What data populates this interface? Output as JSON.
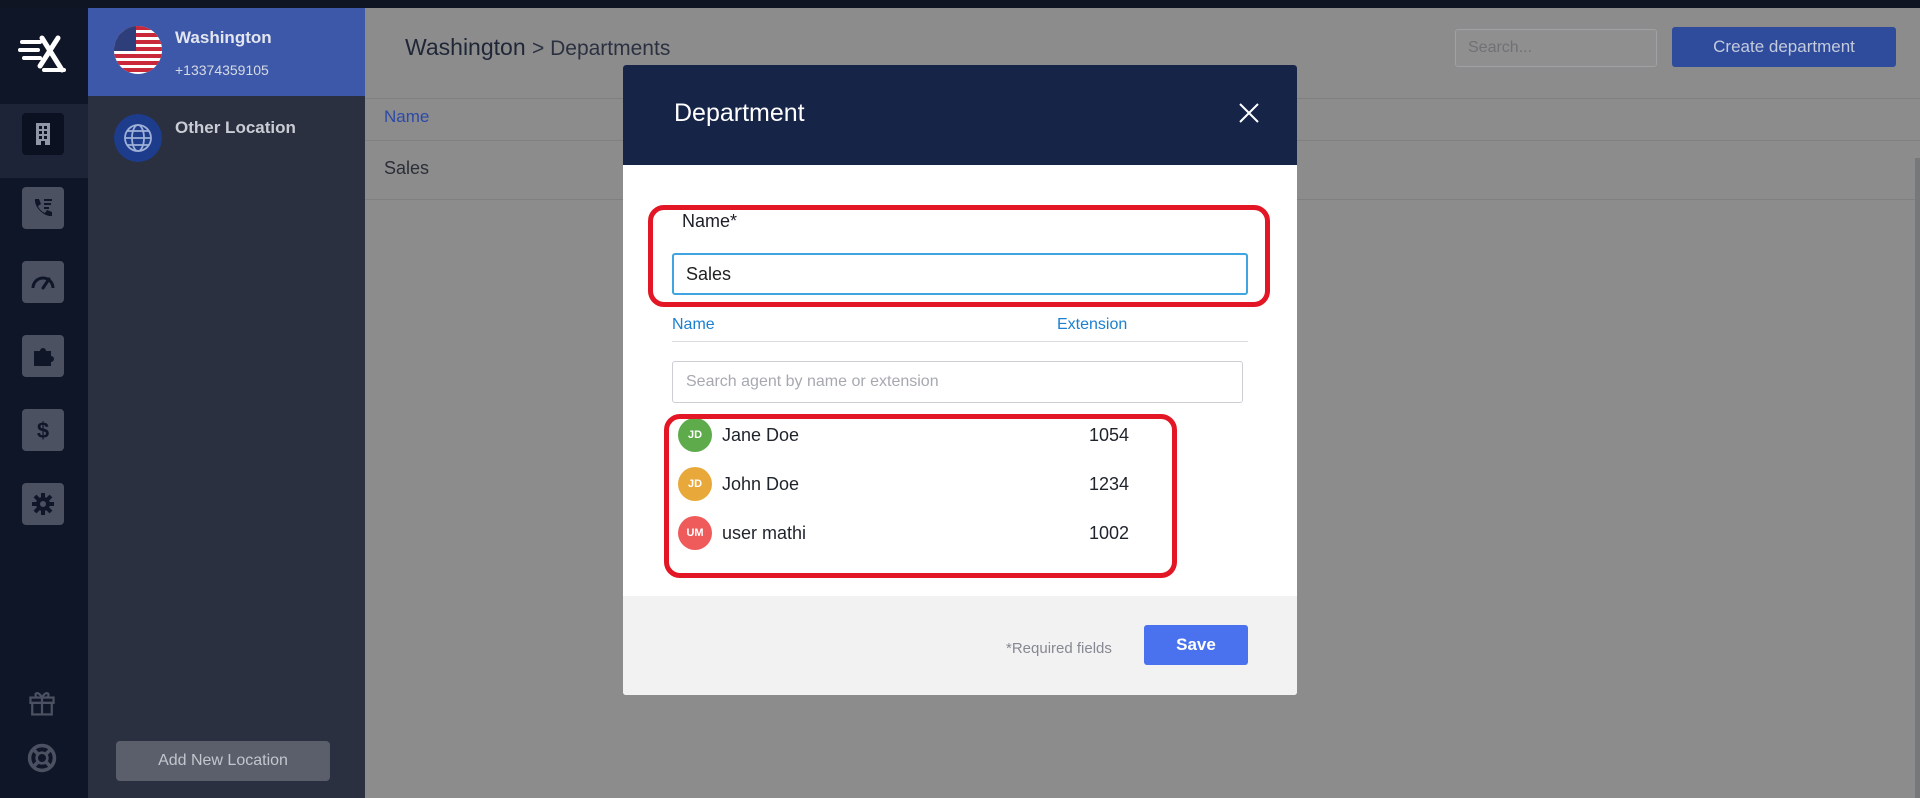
{
  "locations": [
    {
      "name": "Washington",
      "phone": "+13374359105",
      "selected": true
    },
    {
      "name": "Other Location",
      "phone": "",
      "selected": false
    }
  ],
  "sidebar": {
    "add_location_label": "Add New Location"
  },
  "rail": {
    "icons": [
      "logo-icon",
      "building-icon",
      "call-routing-icon",
      "dashboard-gauge-icon",
      "puzzle-icon",
      "dollar-icon",
      "gear-icon",
      "gift-icon",
      "lifebuoy-icon"
    ]
  },
  "header": {
    "breadcrumb_location": "Washington",
    "breadcrumb_section": "> Departments",
    "search_placeholder": "Search...",
    "create_label": "Create department"
  },
  "table": {
    "column_name": "Name",
    "rows": [
      "Sales"
    ]
  },
  "modal": {
    "title": "Department",
    "name_label": "Name*",
    "name_value": "Sales",
    "col_name": "Name",
    "col_extension": "Extension",
    "agent_search_placeholder": "Search agent by name or extension",
    "agents": [
      {
        "initials": "JD",
        "name": "Jane Doe",
        "extension": "1054",
        "color": "#5dab4b"
      },
      {
        "initials": "JD",
        "name": "John Doe",
        "extension": "1234",
        "color": "#e9a93a"
      },
      {
        "initials": "UM",
        "name": "user mathi",
        "extension": "1002",
        "color": "#ef5a5a"
      }
    ],
    "required_note": "*Required fields",
    "save_label": "Save"
  },
  "colors": {
    "accent": "#4a72ee",
    "modal_header": "#162448",
    "highlight": "#e21624",
    "link": "#1c7fd0"
  }
}
